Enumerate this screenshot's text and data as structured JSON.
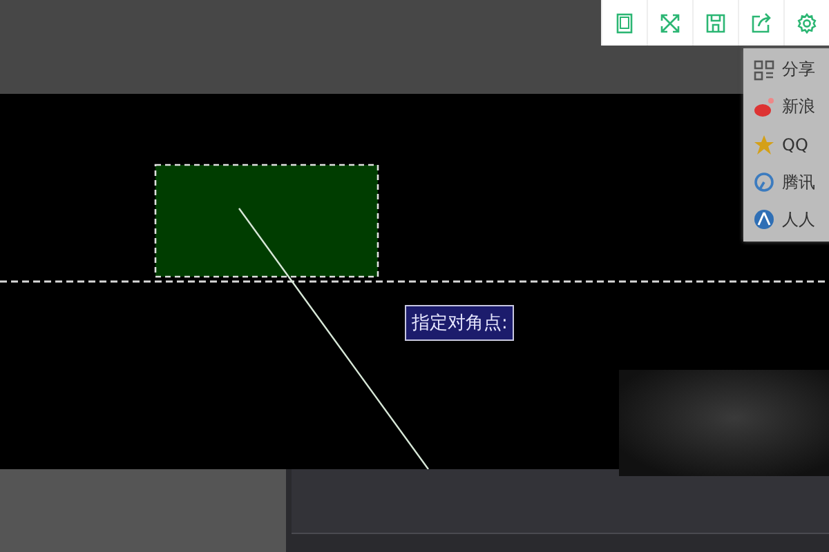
{
  "share_menu": {
    "items": [
      {
        "label": "分享"
      },
      {
        "label": "新浪"
      },
      {
        "label": "QQ"
      },
      {
        "label": "腾讯"
      },
      {
        "label": "人人"
      }
    ]
  },
  "canvas": {
    "prompt": "指定对角点:"
  }
}
